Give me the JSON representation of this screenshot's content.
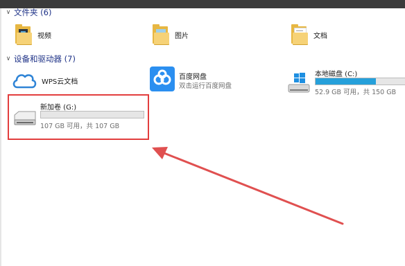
{
  "sections": {
    "folders_header": "文件夹 (6)",
    "devices_header": "设备和驱动器 (7)"
  },
  "folders": [
    {
      "name": "视频",
      "icon": "video-folder-icon"
    },
    {
      "name": "图片",
      "icon": "pictures-folder-icon"
    },
    {
      "name": "文档",
      "icon": "documents-folder-icon"
    }
  ],
  "devices": {
    "wps": {
      "name": "WPS云文档",
      "icon": "cloud-icon"
    },
    "baidu": {
      "name": "百度网盘",
      "desc": "双击运行百度网盘",
      "icon": "baidu-netdisk-icon"
    },
    "cdrive": {
      "name": "本地磁盘 (C:)",
      "free": "52.9 GB 可用，共 150 GB",
      "used_fraction": 0.65,
      "icon": "windows-drive-icon"
    },
    "gdrive": {
      "name": "新加卷 (G:)",
      "free": "107 GB 可用，共 107 GB",
      "used_fraction": 0.0,
      "icon": "hard-drive-icon"
    }
  },
  "colors": {
    "header_text": "#1e3287",
    "bar_fill": "#26a0da",
    "highlight": "#e23d3d",
    "arrow": "#e05050"
  }
}
